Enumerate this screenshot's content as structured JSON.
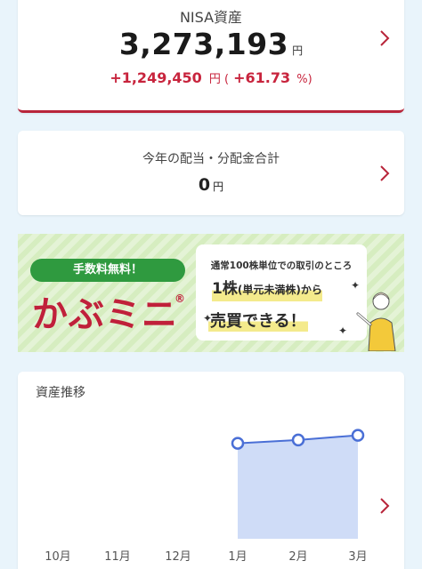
{
  "nisa": {
    "label": "NISA資産",
    "amount": "3,273,193",
    "unit": "円",
    "gain_amount": "+1,249,450",
    "gain_unit": "円 (",
    "gain_pct": "+61.73",
    "gain_pct_suffix": "%)"
  },
  "dividend": {
    "label": "今年の配当・分配金合計",
    "amount": "0",
    "unit": "円"
  },
  "banner": {
    "fee_text": "手数料無料！",
    "brand": "かぶミニ",
    "brand_mark": "®",
    "line1": "通常100株単位での取引のところ",
    "line2_main": "1株",
    "line2_paren": "(単元未満株)",
    "line2_tail": "から",
    "line3": "売買できる！"
  },
  "chart": {
    "title": "資産推移"
  },
  "chart_data": {
    "type": "area",
    "categories": [
      "10月",
      "11月",
      "12月",
      "1月",
      "2月",
      "3月"
    ],
    "values": [
      null,
      null,
      null,
      3175000,
      3215000,
      3273193
    ],
    "ylim": [
      2000000,
      3400000
    ],
    "grid": false,
    "colors": {
      "line": "#4a6fd6",
      "fill": "#cfdcf7"
    }
  },
  "icons": {
    "chevron": "chevron-right-icon"
  },
  "colors": {
    "accent_red": "#c8243d",
    "background": "#e9f4fb"
  }
}
